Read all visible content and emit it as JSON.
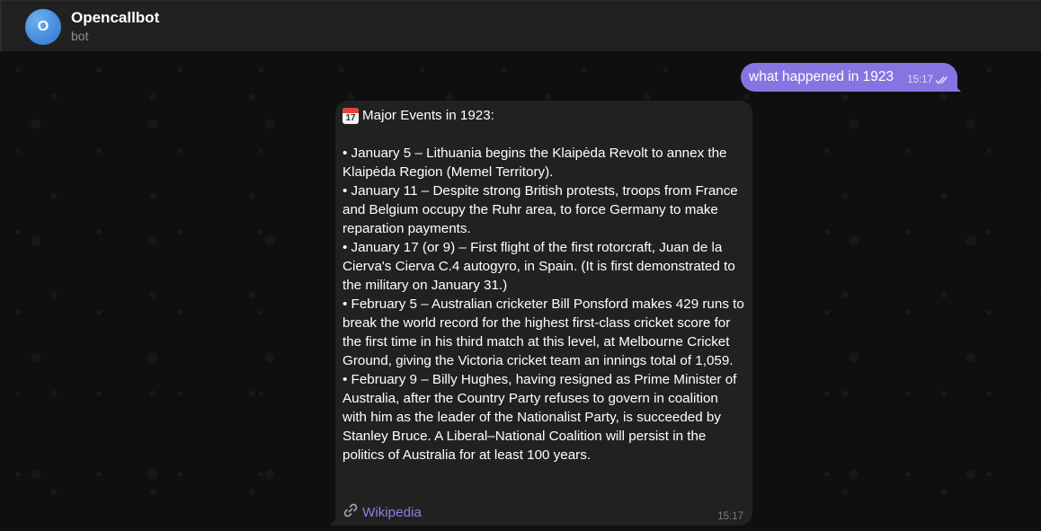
{
  "header": {
    "avatar_letter": "O",
    "title": "Opencallbot",
    "subtitle": "bot"
  },
  "messages": {
    "outgoing": {
      "text": "what happened in 1923",
      "time": "15:17",
      "status_icon": "double-check-icon"
    },
    "incoming": {
      "heading_icon": "calendar-icon",
      "heading_icon_day": "17",
      "heading": "Major Events in 1923:",
      "events": [
        "• January 5 – Lithuania begins the Klaipėda Revolt to annex the Klaipėda Region (Memel Territory).",
        "• January 11 – Despite strong British protests, troops from France and Belgium occupy the Ruhr area, to force Germany to make reparation payments.",
        "• January 17 (or 9) – First flight of the first rotorcraft, Juan de la Cierva's Cierva C.4 autogyro, in Spain. (It is first demonstrated to the military on January 31.)",
        "• February 5 – Australian cricketer Bill Ponsford makes 429 runs to break the world record for the highest first-class cricket score for the first time in his third match at this level, at Melbourne Cricket Ground, giving the Victoria cricket team an innings total of 1,059.",
        "• February 9 – Billy Hughes, having resigned as Prime Minister of Australia, after the Country Party refuses to govern in coalition with him as the leader of the Nationalist Party, is succeeded by Stanley Bruce. A Liberal–National Coalition will persist in the politics of Australia for at least 100 years."
      ],
      "link_icon": "link-icon",
      "link_text": "Wikipedia",
      "time": "15:17"
    }
  },
  "colors": {
    "outgoing_bubble": "#8774e1",
    "incoming_bubble": "#212121",
    "link": "#8d7fe6",
    "avatar": "#4a90e2"
  }
}
